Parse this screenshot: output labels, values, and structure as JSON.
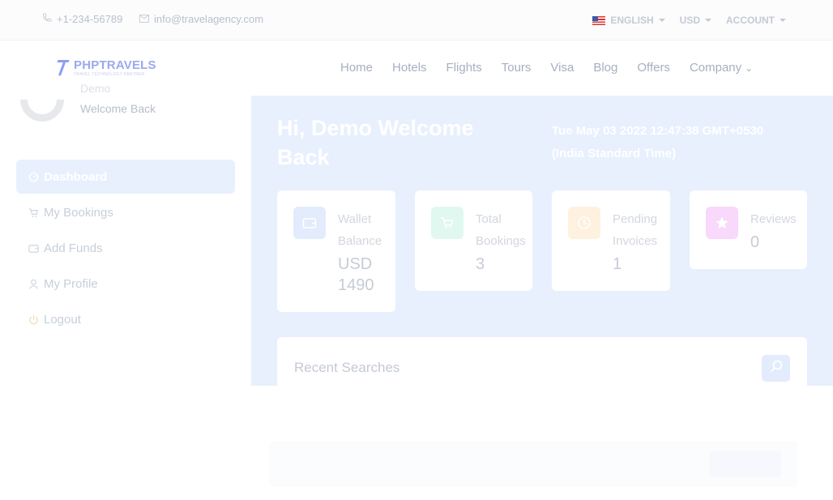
{
  "topbar": {
    "phone": "+1-234-56789",
    "email": "info@travelagency.com",
    "language": "ENGLISH",
    "currency": "USD",
    "account": "ACCOUNT"
  },
  "brand": {
    "name": "PHPTRAVELS",
    "tagline": "TRAVEL TECHNOLOGY PARTNER"
  },
  "nav": {
    "items": [
      "Home",
      "Hotels",
      "Flights",
      "Tours",
      "Visa",
      "Blog",
      "Offers",
      "Company"
    ]
  },
  "sidebar": {
    "user_name": "Demo",
    "welcome": "Welcome Back",
    "items": [
      {
        "label": "Dashboard",
        "icon": "dashboard-icon",
        "active": true
      },
      {
        "label": "My Bookings",
        "icon": "cart-icon"
      },
      {
        "label": "Add Funds",
        "icon": "wallet-icon"
      },
      {
        "label": "My Profile",
        "icon": "user-icon"
      },
      {
        "label": "Logout",
        "icon": "power-icon"
      }
    ]
  },
  "main": {
    "greeting": "Hi, Demo Welcome Back",
    "datetime": "Tue May 03 2022 12:47:38 GMT+0530 (India Standard Time)",
    "stats": [
      {
        "label": "Wallet Balance",
        "value": "USD 1490",
        "icon": "wallet-icon",
        "color": "#e3ecfd"
      },
      {
        "label": "Total Bookings",
        "value": "3",
        "icon": "cart-icon",
        "color": "#e0f8ef"
      },
      {
        "label": "Pending Invoices",
        "value": "1",
        "icon": "clock-icon",
        "color": "#fff1df"
      },
      {
        "label": "Reviews",
        "value": "0",
        "icon": "star-icon",
        "color": "#f8d8fb"
      }
    ],
    "recent_title": "Recent Searches"
  }
}
